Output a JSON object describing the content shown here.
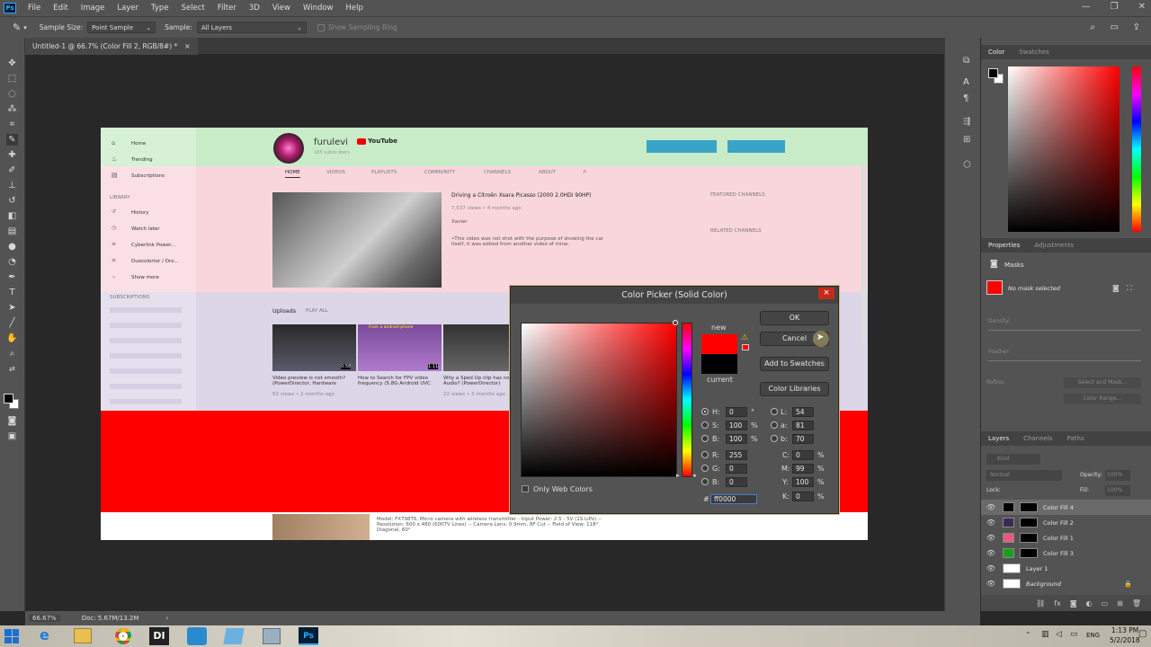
{
  "app": {
    "logo": "Ps"
  },
  "menu": [
    "File",
    "Edit",
    "Image",
    "Layer",
    "Type",
    "Select",
    "Filter",
    "3D",
    "View",
    "Window",
    "Help"
  ],
  "options": {
    "sample_size_label": "Sample Size:",
    "sample_size_value": "Point Sample",
    "sample_label": "Sample:",
    "sample_value": "All Layers",
    "show_ring": "Show Sampling Ring"
  },
  "doc_tab": {
    "title": "Untitled-1 @ 66.7% (Color Fill 2, RGB/8#) *",
    "close": "×"
  },
  "status": {
    "zoom": "66.67%",
    "doc": "Doc: 5.67M/13.2M"
  },
  "youtube": {
    "side": [
      "Home",
      "Trending",
      "Subscriptions"
    ],
    "library_label": "LIBRARY",
    "library": [
      "History",
      "Watch later",
      "Cyberlink Power...",
      "Duocolortor / Dro...",
      "Show more"
    ],
    "subs_label": "SUBSCRIPTIONS",
    "channel": "furulevi",
    "yt": "YouTube",
    "sub_count": "165 subscribers",
    "tabs": [
      "HOME",
      "VIDEOS",
      "PLAYLISTS",
      "COMMUNITY",
      "CHANNELS",
      "ABOUT"
    ],
    "featured_title": "Driving a Citroën Xsara Picasso (2000 2.0HDi 90HP)",
    "featured_meta": "7,537 views • 4 months ago",
    "featured_author": "Xavier",
    "featured_desc": "•This video was not shot with the purpose of showing the car itself, it was edited from another video of mine.",
    "featured_channels": "FEATURED CHANNELS",
    "related_channels": "RELATED CHANNELS",
    "uploads": "Uploads",
    "play_all": "PLAY ALL",
    "videos": [
      {
        "title": "Video preview is not smooth? (PowerDirector, Hardware",
        "views": "62 views • 2 months ago",
        "dur": "0:58"
      },
      {
        "title": "How to Search for FPV video frequency (5.8G Android UVC",
        "views": "",
        "dur": "1:11"
      },
      {
        "title": "Why a Sped Up clip has no Audio? (PowerDirector)",
        "views": "22 views • 3 months ago",
        "dur": ""
      }
    ],
    "thumb2_text": "From a android phone",
    "bottom_desc": "Model: FX798T6, Micro camera with wireless transmitter - Input Power: 2.5 - 5V (1S LiPo) -- Resolution: 600 x 480 (600TV Lines) -- Camera Lens: 0.9mm, 8F Cut -- Field of View: 118° Diagonal, 60°",
    "btn1": "",
    "btn2": ""
  },
  "dialog": {
    "title": "Color Picker (Solid Color)",
    "close": "×",
    "ok": "OK",
    "cancel": "Cancel",
    "add_swatches": "Add to Swatches",
    "color_libraries": "Color Libraries",
    "new": "new",
    "current": "current",
    "only_web": "Only Web Colors",
    "H": "0",
    "S": "100",
    "B": "100",
    "R": "255",
    "G": "0",
    "Bb": "0",
    "L": "54",
    "a": "81",
    "b": "70",
    "C": "0",
    "M": "99",
    "Y": "100",
    "K": "0",
    "hex": "ff0000",
    "deg": "°",
    "pct": "%",
    "labels": {
      "H": "H:",
      "S": "S:",
      "B": "B:",
      "R": "R:",
      "G": "G:",
      "Bb": "B:",
      "L": "L:",
      "a": "a:",
      "b": "b:",
      "C": "C:",
      "M": "M:",
      "Y": "Y:",
      "K": "K:",
      "hash": "#"
    },
    "new_color": "#ff0000",
    "current_color": "#000000"
  },
  "panels": {
    "color_tabs": [
      "Color",
      "Swatches"
    ],
    "props_tabs": [
      "Properties",
      "Adjustments"
    ],
    "masks": "Masks",
    "no_mask": "No mask selected",
    "density": "Density:",
    "feather": "Feather:",
    "refine": "Refine:",
    "select_mask": "Select and Mask...",
    "color_range": "Color Range...",
    "layers_tabs": [
      "Layers",
      "Channels",
      "Paths"
    ],
    "kind": "Kind",
    "normal": "Normal",
    "opacity": "Opacity:",
    "opacity_val": "100%",
    "lock": "Lock:",
    "fill": "Fill:",
    "fill_val": "100%",
    "layers": [
      {
        "name": "Color Fill 4",
        "color": "#000000",
        "type": "fill"
      },
      {
        "name": "Color Fill 2",
        "color": "#3b2a55",
        "type": "fill"
      },
      {
        "name": "Color Fill 1",
        "color": "#e85a7a",
        "type": "fill"
      },
      {
        "name": "Color Fill 3",
        "color": "#18a018",
        "type": "fill"
      },
      {
        "name": "Layer 1",
        "color": "#ffffff",
        "type": "pixel"
      },
      {
        "name": "Background",
        "color": "#ffffff",
        "type": "bg"
      }
    ]
  },
  "taskbar": {
    "time": "1:13 PM",
    "date": "5/2/2018",
    "lang": "ENG"
  }
}
